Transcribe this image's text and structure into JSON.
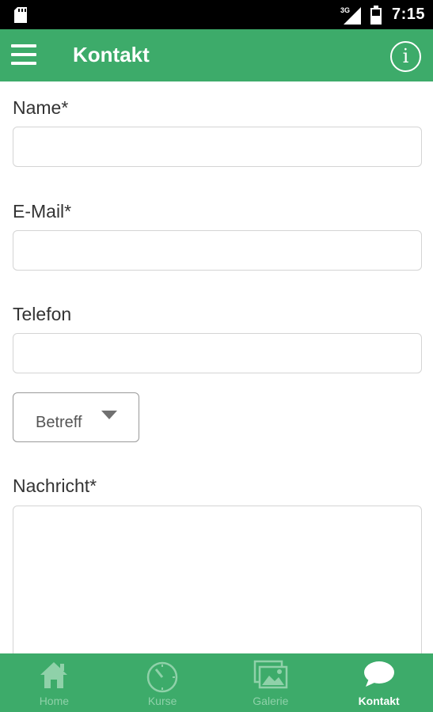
{
  "status_bar": {
    "network": "3G",
    "time": "7:15",
    "icons": [
      "sd-card-icon",
      "signal-icon",
      "battery-icon"
    ]
  },
  "app_bar": {
    "title": "Kontakt",
    "menu_icon": "hamburger-menu-icon",
    "info_icon": "info-icon",
    "info_glyph": "i",
    "background": "#3dab6a"
  },
  "form": {
    "name_label": "Name*",
    "name_value": "",
    "email_label": "E-Mail*",
    "email_value": "",
    "phone_label": "Telefon",
    "phone_value": "",
    "subject_select": "Betreff",
    "message_label": "Nachricht*",
    "message_value": ""
  },
  "bottom_nav": {
    "items": [
      {
        "label": "Home",
        "icon": "home-icon",
        "active": false
      },
      {
        "label": "Kurse",
        "icon": "timer-icon",
        "active": false
      },
      {
        "label": "Galerie",
        "icon": "gallery-icon",
        "active": false
      },
      {
        "label": "Kontakt",
        "icon": "chat-bubble-icon",
        "active": true
      }
    ]
  },
  "colors": {
    "accent": "#3dab6a",
    "inactive_nav": "#8fd1a9",
    "active_nav": "#ffffff"
  }
}
